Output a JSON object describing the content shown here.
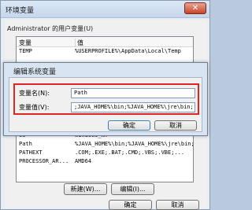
{
  "outer": {
    "title": "环境变量",
    "close_glyph": "✕",
    "user_vars_label": "Administrator 的用户变量(U)",
    "user_table": {
      "headers": [
        "变量",
        "值"
      ],
      "rows": [
        [
          "TEMP",
          "%USERPROFILE%\\AppData\\Local\\Temp"
        ]
      ]
    },
    "sys_table": {
      "rows": [
        [
          "OS",
          "Windows_NT"
        ],
        [
          "Path",
          "%JAVA_HOME%\\bin;%JAVA_HOME%\\jre\\bin;..."
        ],
        [
          "PATHEXT",
          ".COM;.EXE;.BAT;.CMD;.VBS;.VBE;..."
        ],
        [
          "PROCESSOR_AR...",
          "AMD64"
        ]
      ]
    },
    "new_label": "新建(W)...",
    "edit_label": "编辑(I)...",
    "ok_label": "确定",
    "cancel_label": "取消"
  },
  "dialog": {
    "title": "编辑系统变量",
    "name_label": "变量名(N):",
    "value_label": "变量值(V):",
    "name_value": "Path",
    "value_value": ";JAVA_HOME%\\bin;%JAVA_HOME%\\jre\\bin;",
    "ok_label": "确定",
    "cancel_label": "取消"
  },
  "colors": {
    "highlight": "#e02424",
    "titlebar": "#c5d7ec"
  }
}
